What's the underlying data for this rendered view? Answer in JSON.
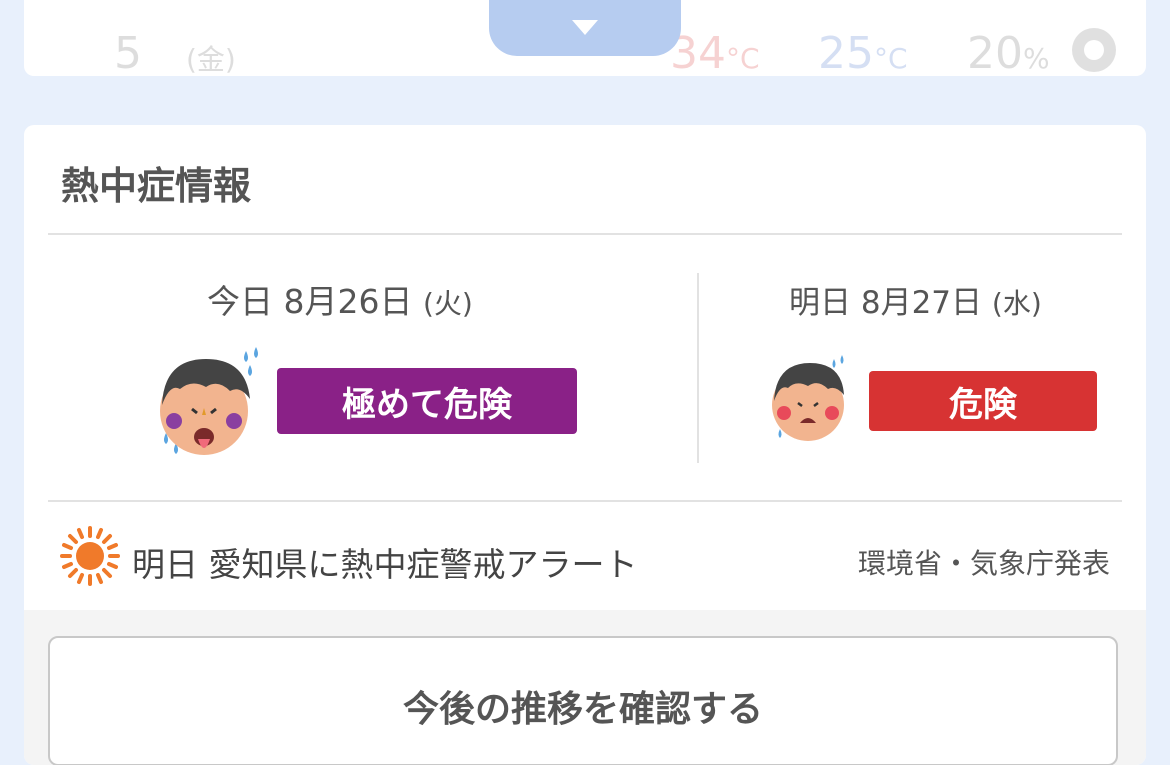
{
  "forecast_row": {
    "date": "5",
    "dow": "(金)",
    "high_value": "34",
    "high_unit": "°C",
    "low_value": "25",
    "low_unit": "°C",
    "precip_value": "20",
    "precip_unit": "%"
  },
  "heatstroke": {
    "title": "熱中症情報",
    "today": {
      "label": "今日 8月26日",
      "dow": "(火)",
      "level": "極めて危険",
      "color": "#8a2187",
      "icon": "exhausted-face-icon"
    },
    "tomorrow": {
      "label": "明日 8月27日",
      "dow": "(水)",
      "level": "危険",
      "color": "#d73333",
      "icon": "sweating-face-icon"
    },
    "alert": {
      "icon": "sun-icon",
      "text": "明日 愛知県に熱中症警戒アラート",
      "source": "環境省・気象庁発表"
    },
    "trend_button": "今後の推移を確認する"
  }
}
